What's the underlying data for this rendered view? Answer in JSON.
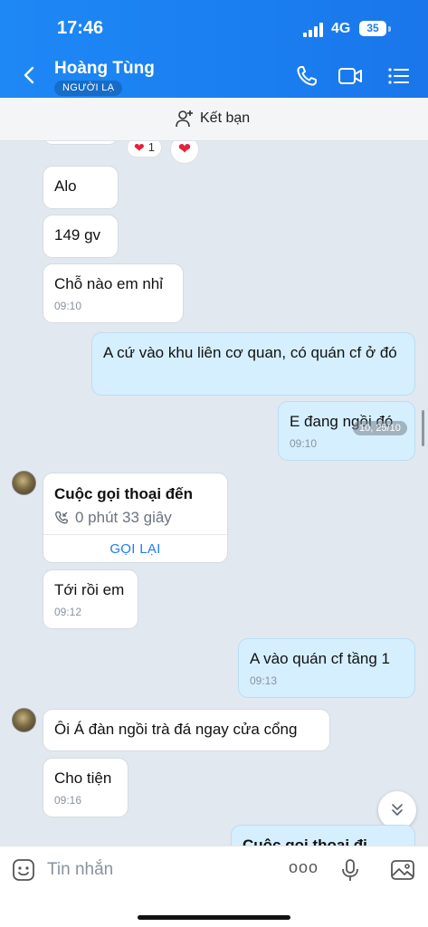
{
  "status_bar": {
    "time": "17:46",
    "network": "4G",
    "battery": "35"
  },
  "header": {
    "contact_name": "Hoàng Tùng",
    "badge": "NGƯỜI LẠ",
    "icons": [
      "back-arrow-icon",
      "phone-icon",
      "video-call-icon",
      "menu-list-icon"
    ]
  },
  "add_friend": {
    "label": "Kết bạn"
  },
  "messages": {
    "reaction_count": "1",
    "m1": {
      "text": "Alo"
    },
    "m2": {
      "text": "149 gv"
    },
    "m3": {
      "text": "Chỗ nào em nhỉ",
      "time": "09:10"
    },
    "m4": {
      "text": "A cứ vào khu liên cơ quan, có quán cf ở đó"
    },
    "m5": {
      "text": "E đang ngồi đó",
      "time": "09:10"
    },
    "date_chip": "10, 25/10",
    "call": {
      "title": "Cuộc gọi thoại đến",
      "duration": "0 phút 33 giây",
      "action": "GỌI LẠI"
    },
    "m6": {
      "text": "Tới rồi em",
      "time": "09:12"
    },
    "m7": {
      "text": "A vào quán cf tầng 1",
      "time": "09:13"
    },
    "m8": {
      "text": "Ôi Á đàn ngồi trà đá ngay cửa cổng"
    },
    "m9": {
      "text": "Cho tiện",
      "time": "09:16"
    },
    "m10": {
      "text": "Cuộc gọi thoại đi"
    }
  },
  "input": {
    "placeholder": "Tin nhắn",
    "more_label": "ooo"
  },
  "colors": {
    "accent": "#1a7ef0",
    "mine_bubble": "#d5efff",
    "chat_bg": "#e2e8f0"
  }
}
